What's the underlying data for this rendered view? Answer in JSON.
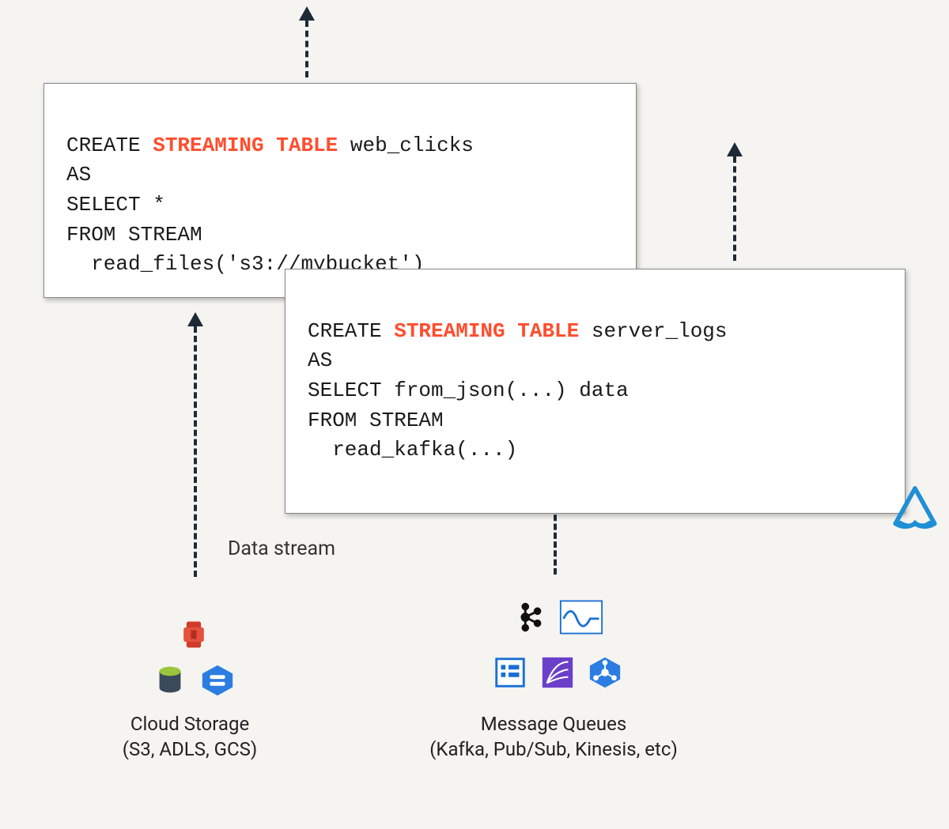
{
  "code_box_1": {
    "line1_a": "CREATE ",
    "line1_b": "STREAMING TABLE",
    "line1_c": " web_clicks",
    "line2": "AS",
    "line3": "SELECT *",
    "line4": "FROM STREAM",
    "line5": "  read_files('s3://mybucket')"
  },
  "code_box_2": {
    "line1_a": "CREATE ",
    "line1_b": "STREAMING TABLE",
    "line1_c": " server_logs",
    "line2": "AS",
    "line3": "SELECT from_json(...) data",
    "line4": "FROM STREAM",
    "line5": "  read_kafka(...)"
  },
  "labels": {
    "data_stream": "Data stream",
    "cloud_storage_title": "Cloud Storage",
    "cloud_storage_sub": "(S3, ADLS, GCS)",
    "mq_title": "Message Queues",
    "mq_sub": "(Kafka, Pub/Sub, Kinesis, etc)"
  },
  "icons": {
    "delta": "delta-lake-logo",
    "storage": [
      "s3-icon",
      "adls-icon",
      "gcs-icon"
    ],
    "message_queues": [
      "kafka-icon",
      "pulsar-icon",
      "eventhub-icon",
      "kinesis-icon",
      "pubsub-icon"
    ]
  }
}
